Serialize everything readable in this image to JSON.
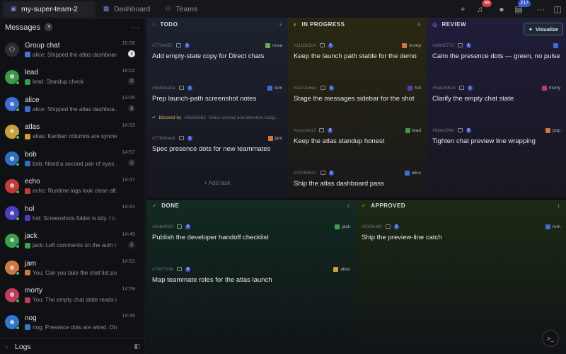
{
  "top": {
    "team_tab": "my-super-team-2",
    "dashboard_tab": "Dashboard",
    "teams_tab": "Teams",
    "notif_count": "99",
    "agents_count": "217"
  },
  "sidebar": {
    "title": "Messages",
    "count": "3",
    "conversations": [
      {
        "name": "Group chat",
        "preview": "alice: Shipped the atlas dashboard...",
        "time": "15:08",
        "badge": "3",
        "badge_style": "white",
        "avatar_color": "#2a2c33",
        "avatar_glyph": "⚇",
        "status": "",
        "mini_color": "#4f6fd8"
      },
      {
        "name": "lead",
        "preview": "lead: Standup check",
        "time": "15:02",
        "badge": "2",
        "badge_style": "dark",
        "avatar_color": "#3a9a4a",
        "avatar_glyph": "☻",
        "status": "#3fbf5f",
        "mini_color": "#3a9a4a"
      },
      {
        "name": "alice",
        "preview": "alice: Shipped the atlas dashboa...",
        "time": "13:06",
        "badge": "3",
        "badge_style": "dark",
        "avatar_color": "#3b6fd4",
        "avatar_glyph": "☻",
        "status": "#3fbf5f",
        "mini_color": "#3b6fd4"
      },
      {
        "name": "atlas",
        "preview": "atlas: Kanban columns are synced...",
        "time": "14:53",
        "badge": "",
        "badge_style": "",
        "avatar_color": "#c9a233",
        "avatar_glyph": "☻",
        "status": "#3fbf5f",
        "mini_color": "#c9a233"
      },
      {
        "name": "bob",
        "preview": "bob: Need a second pair of eyes ...",
        "time": "14:57",
        "badge": "1",
        "badge_style": "dark",
        "avatar_color": "#2f6fc2",
        "avatar_glyph": "☻",
        "status": "#3fbf5f",
        "mini_color": "#2f6fc2"
      },
      {
        "name": "echo",
        "preview": "echo: Runtime logs look clean aft...",
        "time": "14:47",
        "badge": "",
        "badge_style": "",
        "avatar_color": "#c83a3a",
        "avatar_glyph": "☻",
        "status": "#3fbf5f",
        "mini_color": "#c83a3a"
      },
      {
        "name": "hol",
        "preview": "hol: Screenshots folder is tidy. I c...",
        "time": "14:41",
        "badge": "",
        "badge_style": "",
        "avatar_color": "#4a3fc4",
        "avatar_glyph": "☻",
        "status": "#3fbf5f",
        "mini_color": "#4a3fc4"
      },
      {
        "name": "jack",
        "preview": "jack: Left comments on the auth r...",
        "time": "14:49",
        "badge": "1",
        "badge_style": "dark",
        "avatar_color": "#3aa24a",
        "avatar_glyph": "☻",
        "status": "#3fbf5f",
        "mini_color": "#3aa24a"
      },
      {
        "name": "jam",
        "preview": "You: Can you take the chat list polish...",
        "time": "14:51",
        "badge": "",
        "badge_style": "",
        "avatar_color": "#d0783a",
        "avatar_glyph": "☻",
        "status": "#3fbf5f",
        "mini_color": "#d0783a"
      },
      {
        "name": "morty",
        "preview": "You: The empty chat state reads muc...",
        "time": "14:59",
        "badge": "",
        "badge_style": "",
        "avatar_color": "#c33a5a",
        "avatar_glyph": "☻",
        "status": "#3fbf5f",
        "mini_color": "#c33a5a"
      },
      {
        "name": "nog",
        "preview": "nog: Presence dots are wired. Onl...",
        "time": "14:39",
        "badge": "",
        "badge_style": "",
        "avatar_color": "#2f7ad0",
        "avatar_glyph": "☻",
        "status": "#3fbf5f",
        "mini_color": "#2f7ad0"
      }
    ],
    "footer": "Logs"
  },
  "board": {
    "visualize_label": "Visualize",
    "add_task_label": "Add task",
    "columns": [
      {
        "key": "todo",
        "label": "TODO",
        "count": "3",
        "color": "#5a7ad8",
        "icon": "○",
        "cards": [
          {
            "id": "#7724d52",
            "comments": "1",
            "assignee": "nova",
            "assignee_color": "#6aa84f",
            "title": "Add empty-state copy for Direct chats"
          },
          {
            "id": "#8a90ea0a",
            "comments": "1",
            "assignee": "tom",
            "assignee_color": "#3b6fd4",
            "title": "Prep launch-path screenshot notes"
          },
          {
            "id": "#7788bee9",
            "comments": "1",
            "assignee": "jam",
            "assignee_color": "#d0783a",
            "title": "Spec presence dots for new teammates"
          }
        ],
        "blocked": {
          "label": "Blocked by",
          "ref": "#f5e8e5b2",
          "text": "Make unread and attention badg..."
        }
      },
      {
        "key": "in_progress",
        "label": "IN PROGRESS",
        "count": "6",
        "color": "#d6b25a",
        "icon": "◐",
        "cards": [
          {
            "id": "#11bdb5d4",
            "comments": "1",
            "assignee": "trump",
            "assignee_color": "#d0783a",
            "title": "Keep the launch path stable for the demo"
          },
          {
            "id": "#4d72e6ee",
            "comments": "1",
            "assignee": "hol",
            "assignee_color": "#4a3fc4",
            "title": "Stage the messages sidebar for the shot"
          },
          {
            "id": "#acccde13",
            "comments": "2",
            "assignee": "lead",
            "assignee_color": "#3a9a4a",
            "title": "Keep the atlas standup honest"
          },
          {
            "id": "#7d7690d1",
            "comments": "1",
            "assignee": "alice",
            "assignee_color": "#3b6fd4",
            "title": "Ship the atlas dashboard pass"
          }
        ]
      },
      {
        "key": "review",
        "label": "REVIEW",
        "count": "",
        "color": "#8a7ad8",
        "icon": "◎",
        "cards": [
          {
            "id": "#a9fd5772",
            "comments": "1",
            "assignee": "",
            "assignee_color": "#3b6fd4",
            "title": "Calm the presence dots — green, no pulse"
          },
          {
            "id": "#5ab3661b",
            "comments": "1",
            "assignee": "morty",
            "assignee_color": "#c33a5a",
            "title": "Clarify the empty chat state"
          },
          {
            "id": "#fddeb94d",
            "comments": "2",
            "assignee": "pop",
            "assignee_color": "#d0783a",
            "title": "Tighten chat preview line wrapping"
          }
        ]
      },
      {
        "key": "done",
        "label": "DONE",
        "count": "2",
        "color": "#3fbf5f",
        "icon": "✓",
        "cards": [
          {
            "id": "#6cbd491f",
            "comments": "0",
            "assignee": "jack",
            "assignee_color": "#3aa24a",
            "title": "Publish the developer handoff checklist"
          },
          {
            "id": "#78379cfb",
            "comments": "0",
            "assignee": "atlas",
            "assignee_color": "#c9a233",
            "title": "Map teammate roles for the atlas launch"
          }
        ]
      },
      {
        "key": "approved",
        "label": "APPROVED",
        "count": "1",
        "color": "#7fbf3a",
        "icon": "✓",
        "cards": [
          {
            "id": "#21f3cd6f",
            "comments": "2",
            "assignee": "rom",
            "assignee_color": "#3b6fd4",
            "title": "Ship the preview-line catch"
          }
        ]
      }
    ]
  }
}
